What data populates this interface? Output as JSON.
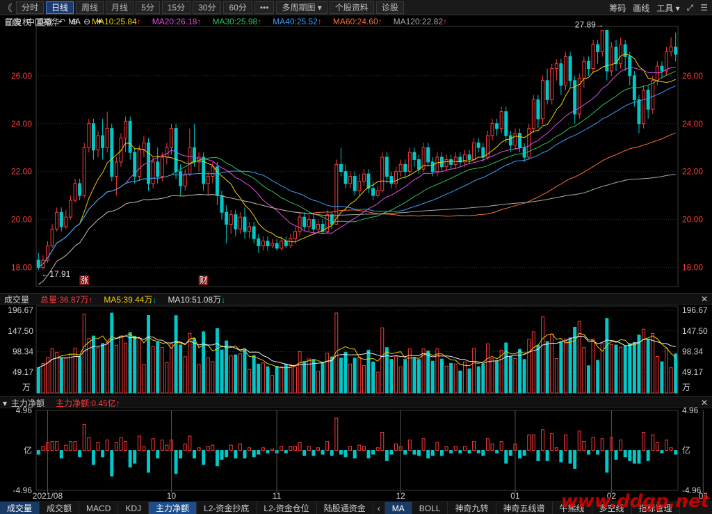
{
  "toolbar": {
    "back": "《",
    "buttons": [
      "分时",
      "日线",
      "周线",
      "月线",
      "5分",
      "15分",
      "30分",
      "60分",
      "•••",
      "多周期图",
      "个股资料",
      "诊股"
    ],
    "active": "日线",
    "right": [
      "筹码",
      "画线",
      "工具"
    ]
  },
  "main": {
    "period": "日线",
    "stock": "中国神华",
    "ma_label": "MA",
    "ma": [
      {
        "label": "MA10:25.84",
        "color": "#f5d000"
      },
      {
        "label": "MA20:26.18",
        "color": "#e050e0"
      },
      {
        "label": "MA30:25.98",
        "color": "#30c060"
      },
      {
        "label": "MA40:25.52",
        "color": "#3aa0ff"
      },
      {
        "label": "MA60:24.60",
        "color": "#ff7030"
      },
      {
        "label": "MA120:22.82",
        "color": "#aaaaaa"
      }
    ],
    "right_controls": [
      "前复权",
      "重载"
    ],
    "y_ticks": [
      "26.00",
      "24.00",
      "22.00",
      "20.00",
      "18.00"
    ],
    "y_values": [
      26,
      24,
      22,
      20,
      18
    ],
    "high_label": "27.89→",
    "low_label": "←17.91",
    "markers": [
      "涨",
      "财"
    ]
  },
  "volume": {
    "title": "成交量",
    "total": "总量:36.87万",
    "ma5": "MA5:39.44万",
    "ma10": "MA10:51.08万",
    "y_ticks": [
      "196.67",
      "147.50",
      "98.34",
      "49.17",
      "万"
    ]
  },
  "mainforce": {
    "title": "主力净额",
    "value": "主力净额:0.45亿",
    "y_ticks": [
      "4.96",
      "亿",
      "-4.96"
    ]
  },
  "x_axis": [
    "2021/08",
    "10",
    "11",
    "12",
    "01",
    "02",
    "03"
  ],
  "bottom_tabs": [
    "成交量",
    "成交额",
    "MACD",
    "KDJ",
    "主力净额",
    "L2-资金抄底",
    "L2-资金仓位",
    "陆股通资金",
    "MA",
    "BOLL",
    "神奇九转",
    "神奇五线谱",
    "牛熊线",
    "多空线",
    "指标管理"
  ],
  "active_bottom_tab": "主力净额",
  "watermark": "www.ddgp.net",
  "colors": {
    "up": "#ff3b3b",
    "down": "#00c8c8",
    "grid": "#2a2a2a"
  },
  "chart_data": {
    "type": "candlestick",
    "price_range": [
      17.2,
      28.0
    ],
    "candles": [
      [
        18.3,
        18.0,
        18.6,
        17.9
      ],
      [
        18.0,
        18.3,
        18.5,
        17.9
      ],
      [
        18.3,
        18.9,
        19.1,
        18.2
      ],
      [
        18.9,
        19.6,
        19.8,
        18.8
      ],
      [
        19.6,
        20.3,
        20.5,
        19.5
      ],
      [
        20.3,
        19.7,
        20.5,
        19.5
      ],
      [
        19.7,
        20.1,
        20.4,
        19.6
      ],
      [
        20.1,
        20.8,
        21.0,
        20.0
      ],
      [
        20.8,
        21.5,
        21.7,
        20.7
      ],
      [
        21.5,
        21.0,
        21.7,
        20.8
      ],
      [
        21.0,
        23.0,
        23.2,
        20.9
      ],
      [
        23.0,
        24.0,
        24.2,
        22.8
      ],
      [
        24.0,
        22.9,
        24.2,
        22.5
      ],
      [
        22.9,
        23.5,
        23.7,
        22.6
      ],
      [
        23.5,
        23.0,
        24.2,
        22.5
      ],
      [
        23.0,
        23.8,
        24.5,
        22.8
      ],
      [
        23.8,
        21.8,
        24.0,
        21.6
      ],
      [
        21.8,
        22.4,
        22.6,
        21.0
      ],
      [
        22.4,
        23.4,
        23.6,
        22.2
      ],
      [
        23.4,
        24.1,
        24.3,
        22.8
      ],
      [
        24.1,
        22.8,
        24.3,
        22.5
      ],
      [
        22.8,
        21.8,
        23.0,
        21.5
      ],
      [
        21.8,
        22.9,
        23.1,
        21.6
      ],
      [
        22.9,
        23.2,
        23.5,
        22.6
      ],
      [
        23.2,
        21.5,
        23.4,
        21.2
      ],
      [
        21.5,
        22.4,
        22.6,
        21.3
      ],
      [
        22.4,
        21.8,
        23.0,
        21.5
      ],
      [
        21.8,
        22.6,
        22.8,
        21.6
      ],
      [
        22.6,
        23.0,
        23.2,
        22.3
      ],
      [
        23.0,
        23.8,
        24.0,
        22.7
      ],
      [
        23.8,
        22.0,
        24.0,
        21.7
      ],
      [
        22.0,
        21.4,
        22.3,
        21.0
      ],
      [
        21.4,
        21.9,
        22.1,
        21.2
      ],
      [
        21.9,
        23.0,
        23.8,
        21.8
      ],
      [
        23.0,
        22.4,
        24.0,
        22.2
      ],
      [
        22.4,
        22.6,
        22.8,
        22.0
      ],
      [
        22.6,
        21.5,
        22.8,
        21.2
      ],
      [
        21.5,
        21.8,
        22.0,
        21.0
      ],
      [
        21.8,
        22.2,
        22.4,
        21.5
      ],
      [
        22.2,
        21.0,
        22.4,
        20.6
      ],
      [
        21.0,
        20.3,
        21.2,
        20.0
      ],
      [
        20.3,
        19.8,
        20.6,
        19.0
      ],
      [
        19.8,
        20.2,
        20.4,
        19.4
      ],
      [
        20.2,
        19.6,
        20.4,
        19.3
      ],
      [
        19.6,
        20.1,
        20.3,
        19.4
      ],
      [
        20.1,
        19.5,
        20.5,
        19.2
      ],
      [
        19.5,
        19.7,
        19.9,
        19.2
      ],
      [
        19.7,
        19.2,
        19.9,
        19.0
      ],
      [
        19.2,
        18.9,
        19.4,
        18.6
      ],
      [
        18.9,
        19.1,
        19.3,
        18.7
      ],
      [
        19.1,
        18.9,
        19.3,
        18.7
      ],
      [
        18.9,
        19.0,
        19.2,
        18.8
      ],
      [
        19.0,
        18.8,
        19.2,
        18.7
      ],
      [
        18.8,
        19.1,
        19.3,
        18.7
      ],
      [
        19.1,
        18.9,
        19.3,
        18.8
      ],
      [
        18.9,
        19.2,
        19.4,
        18.8
      ],
      [
        19.2,
        19.5,
        19.7,
        19.0
      ],
      [
        19.5,
        20.1,
        20.3,
        19.3
      ],
      [
        20.1,
        19.7,
        20.3,
        19.5
      ],
      [
        19.7,
        20.0,
        20.2,
        19.5
      ],
      [
        20.0,
        19.6,
        20.2,
        19.4
      ],
      [
        19.6,
        19.8,
        20.0,
        19.5
      ],
      [
        19.8,
        19.5,
        20.0,
        19.4
      ],
      [
        19.5,
        20.2,
        20.4,
        19.4
      ],
      [
        20.2,
        19.8,
        20.3,
        19.6
      ],
      [
        19.8,
        22.3,
        22.5,
        19.8
      ],
      [
        22.3,
        22.0,
        23.0,
        21.8
      ],
      [
        22.0,
        21.5,
        22.3,
        21.3
      ],
      [
        21.5,
        21.8,
        22.0,
        21.3
      ],
      [
        21.8,
        21.2,
        22.0,
        21.0
      ],
      [
        21.2,
        21.6,
        21.9,
        21.0
      ],
      [
        21.6,
        21.9,
        22.1,
        21.4
      ],
      [
        21.9,
        21.3,
        22.1,
        21.1
      ],
      [
        21.3,
        21.0,
        21.6,
        20.8
      ],
      [
        21.0,
        21.2,
        21.4,
        20.9
      ],
      [
        21.2,
        22.6,
        22.8,
        21.1
      ],
      [
        22.6,
        21.8,
        22.8,
        21.5
      ],
      [
        21.8,
        21.5,
        22.0,
        21.3
      ],
      [
        21.5,
        22.0,
        22.2,
        21.3
      ],
      [
        22.0,
        22.3,
        22.5,
        21.8
      ],
      [
        22.3,
        22.0,
        22.5,
        21.7
      ],
      [
        22.0,
        22.8,
        23.0,
        21.8
      ],
      [
        22.8,
        22.5,
        23.0,
        22.2
      ],
      [
        22.5,
        22.1,
        22.7,
        21.9
      ],
      [
        22.1,
        23.0,
        23.2,
        22.0
      ],
      [
        23.0,
        22.4,
        23.2,
        22.2
      ],
      [
        22.4,
        22.0,
        22.6,
        21.8
      ],
      [
        22.0,
        22.6,
        22.8,
        21.8
      ],
      [
        22.6,
        22.2,
        22.8,
        22.0
      ],
      [
        22.2,
        22.5,
        22.7,
        22.0
      ],
      [
        22.5,
        22.3,
        22.7,
        22.1
      ],
      [
        22.3,
        22.6,
        22.8,
        22.1
      ],
      [
        22.6,
        22.4,
        22.8,
        22.2
      ],
      [
        22.4,
        22.7,
        22.9,
        22.2
      ],
      [
        22.7,
        22.5,
        22.9,
        22.3
      ],
      [
        22.5,
        23.2,
        23.4,
        22.4
      ],
      [
        23.2,
        23.0,
        23.4,
        22.8
      ],
      [
        23.0,
        22.6,
        23.2,
        22.4
      ],
      [
        22.6,
        23.5,
        23.7,
        22.5
      ],
      [
        23.5,
        24.0,
        24.2,
        23.3
      ],
      [
        24.0,
        23.8,
        24.2,
        23.5
      ],
      [
        23.8,
        24.5,
        24.7,
        23.6
      ],
      [
        24.5,
        23.5,
        24.7,
        23.2
      ],
      [
        23.5,
        23.1,
        23.7,
        22.8
      ],
      [
        23.1,
        23.6,
        23.8,
        22.9
      ],
      [
        23.6,
        23.0,
        23.8,
        22.8
      ],
      [
        23.0,
        22.6,
        23.2,
        22.4
      ],
      [
        22.6,
        23.8,
        24.0,
        22.5
      ],
      [
        23.8,
        25.0,
        25.2,
        23.6
      ],
      [
        25.0,
        24.2,
        25.2,
        23.8
      ],
      [
        24.2,
        25.8,
        26.0,
        24.0
      ],
      [
        25.8,
        25.0,
        26.3,
        24.8
      ],
      [
        25.0,
        26.3,
        26.5,
        24.8
      ],
      [
        26.3,
        26.5,
        26.7,
        25.8
      ],
      [
        26.5,
        25.6,
        26.7,
        25.2
      ],
      [
        25.6,
        26.8,
        27.0,
        25.4
      ],
      [
        26.8,
        25.8,
        27.0,
        25.5
      ],
      [
        25.8,
        24.4,
        26.0,
        24.0
      ],
      [
        24.4,
        25.9,
        26.1,
        24.2
      ],
      [
        25.9,
        26.6,
        26.8,
        25.5
      ],
      [
        26.6,
        26.3,
        26.8,
        26.0
      ],
      [
        26.3,
        27.3,
        27.5,
        26.1
      ],
      [
        27.3,
        27.0,
        27.5,
        26.5
      ],
      [
        27.0,
        27.9,
        27.89,
        26.8
      ],
      [
        27.9,
        26.2,
        27.9,
        25.8
      ],
      [
        26.2,
        27.2,
        27.4,
        26.0
      ],
      [
        27.2,
        26.5,
        27.5,
        26.2
      ],
      [
        26.5,
        27.3,
        27.6,
        26.3
      ],
      [
        27.3,
        26.8,
        27.5,
        26.2
      ],
      [
        26.8,
        26.0,
        27.0,
        25.6
      ],
      [
        26.0,
        25.0,
        26.2,
        24.7
      ],
      [
        25.0,
        24.0,
        25.2,
        23.6
      ],
      [
        24.0,
        25.4,
        25.6,
        23.8
      ],
      [
        25.4,
        24.6,
        25.6,
        24.2
      ],
      [
        24.6,
        25.8,
        26.0,
        24.4
      ],
      [
        25.8,
        26.4,
        26.6,
        25.6
      ],
      [
        26.4,
        26.2,
        26.6,
        25.9
      ],
      [
        26.2,
        27.0,
        27.2,
        26.0
      ],
      [
        27.0,
        27.2,
        27.6,
        26.8
      ],
      [
        27.2,
        26.9,
        27.8,
        26.6
      ]
    ],
    "volume_scale_max": 196.67,
    "mainforce_scale": [
      -4.96,
      4.96
    ]
  }
}
